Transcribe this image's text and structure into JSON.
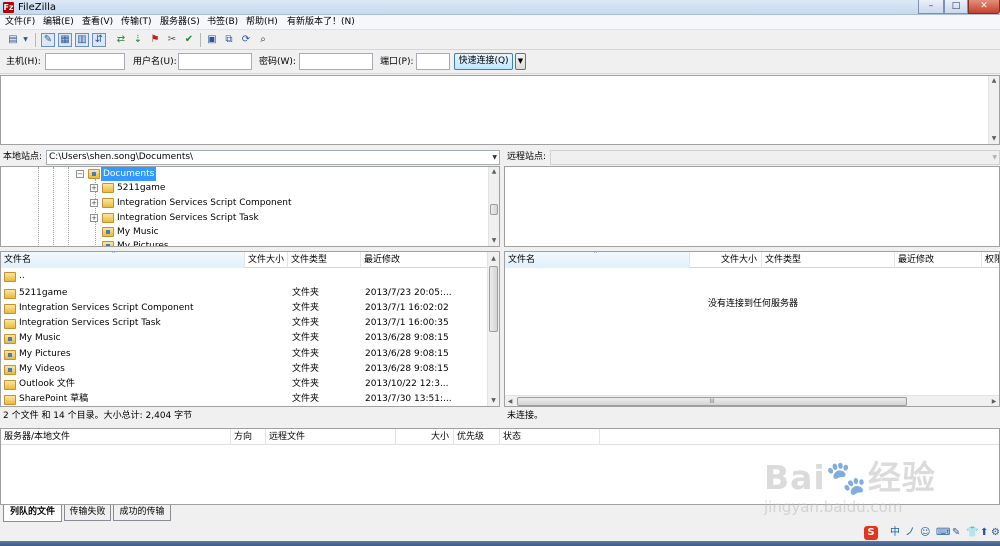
{
  "window": {
    "title": "FileZilla",
    "app_icon": "Fz",
    "controls": {
      "minimize": "–",
      "maximize": "□",
      "close": "✕"
    }
  },
  "menu": [
    "文件(F)",
    "编辑(E)",
    "查看(V)",
    "传输(T)",
    "服务器(S)",
    "书签(B)",
    "帮助(H)",
    "有新版本了！(N)"
  ],
  "toolbar": {
    "icons": [
      "site-manager-icon",
      "dropdown-arrow-icon",
      "toggle-log-icon",
      "toggle-local-tree-icon",
      "toggle-remote-tree-icon",
      "toggle-queue-icon",
      "refresh-icon",
      "process-queue-icon",
      "cancel-icon",
      "disconnect-icon",
      "reconnect-icon",
      "directory-listing-filter-icon",
      "compare-icon",
      "sync-browse-icon",
      "search-icon"
    ]
  },
  "quickconnect": {
    "host_label": "主机(H):",
    "user_label": "用户名(U):",
    "password_label": "密码(W):",
    "port_label": "端口(P):",
    "host_value": "",
    "user_value": "",
    "password_value": "",
    "port_value": "",
    "connect_button": "快速连接(Q)",
    "dropdown": "▼"
  },
  "local": {
    "site_label": "本地站点:",
    "path": "C:\\Users\\shen.song\\Documents\\",
    "tree": [
      {
        "label": "Documents",
        "expander": "−",
        "selected": true
      },
      {
        "label": "5211game",
        "expander": "+"
      },
      {
        "label": "Integration Services Script Component",
        "expander": "+"
      },
      {
        "label": "Integration Services Script Task",
        "expander": "+"
      },
      {
        "label": "My Music",
        "expander": ""
      },
      {
        "label": "My Pictures",
        "expander": ""
      }
    ],
    "columns": [
      "文件名",
      "文件大小",
      "文件类型",
      "最近修改"
    ],
    "files": [
      {
        "name": "..",
        "size": "",
        "type": "",
        "modified": ""
      },
      {
        "name": "5211game",
        "size": "",
        "type": "文件夹",
        "modified": "2013/7/23 20:05:..."
      },
      {
        "name": "Integration Services Script Component",
        "size": "",
        "type": "文件夹",
        "modified": "2013/7/1 16:02:02"
      },
      {
        "name": "Integration Services Script Task",
        "size": "",
        "type": "文件夹",
        "modified": "2013/7/1 16:00:35"
      },
      {
        "name": "My Music",
        "size": "",
        "type": "文件夹",
        "modified": "2013/6/28 9:08:15"
      },
      {
        "name": "My Pictures",
        "size": "",
        "type": "文件夹",
        "modified": "2013/6/28 9:08:15"
      },
      {
        "name": "My Videos",
        "size": "",
        "type": "文件夹",
        "modified": "2013/6/28 9:08:15"
      },
      {
        "name": "Outlook 文件",
        "size": "",
        "type": "文件夹",
        "modified": "2013/10/22 12:3..."
      },
      {
        "name": "SharePoint 草稿",
        "size": "",
        "type": "文件夹",
        "modified": "2013/7/30 13:51:..."
      }
    ],
    "status": "2 个文件 和 14 个目录。大小总计: 2,404 字节"
  },
  "remote": {
    "site_label": "远程站点:",
    "path": "",
    "columns": [
      "文件名",
      "文件大小",
      "文件类型",
      "最近修改",
      "权限"
    ],
    "empty_message": "没有连接到任何服务器",
    "status": "未连接。",
    "hscroll_grip": "III"
  },
  "queue": {
    "columns": [
      "服务器/本地文件",
      "方向",
      "远程文件",
      "大小",
      "优先级",
      "状态"
    ]
  },
  "tabs": [
    "列队的文件",
    "传输失败",
    "成功的传输"
  ],
  "tray": {
    "ime": "S",
    "items": [
      "中",
      "ノ",
      "☺",
      "⌨",
      "✎",
      "👕",
      "⬆",
      "⚙"
    ]
  },
  "watermark": {
    "text": "Bai🐾经验",
    "url": "jingyan.baidu.com"
  },
  "glyphs": {
    "up": "▲",
    "down": "▼",
    "left": "◀",
    "right": "▶",
    "sort": "^"
  }
}
